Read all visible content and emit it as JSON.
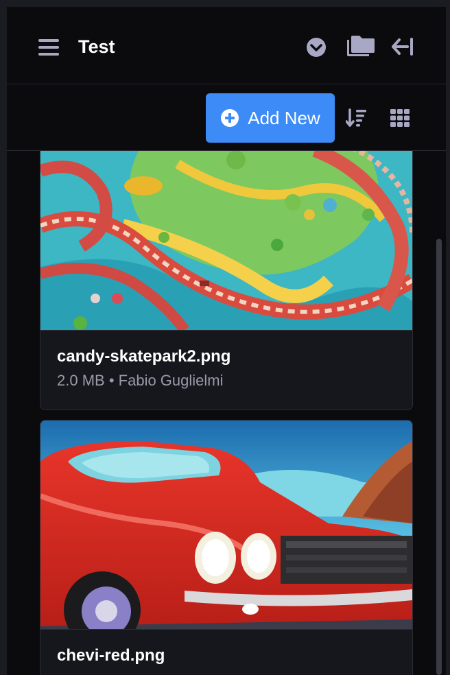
{
  "header": {
    "title": "Test",
    "icons": [
      "menu-icon",
      "chevron-down-circle-icon",
      "folders-icon",
      "collapse-left-icon"
    ]
  },
  "toolbar": {
    "add_label": "Add New",
    "icons": [
      "plus-circle-icon",
      "sort-descending-icon",
      "grid-view-icon"
    ]
  },
  "files": [
    {
      "name": "candy-skatepark2.png",
      "size": "2.0 MB",
      "author": "Fabio Guglielmi",
      "separator": "•"
    },
    {
      "name": "chevi-red.png"
    }
  ],
  "colors": {
    "accent": "#3d8bf6",
    "background": "#0b0b0d",
    "card": "#16161d",
    "icon": "#a9a8c4"
  }
}
